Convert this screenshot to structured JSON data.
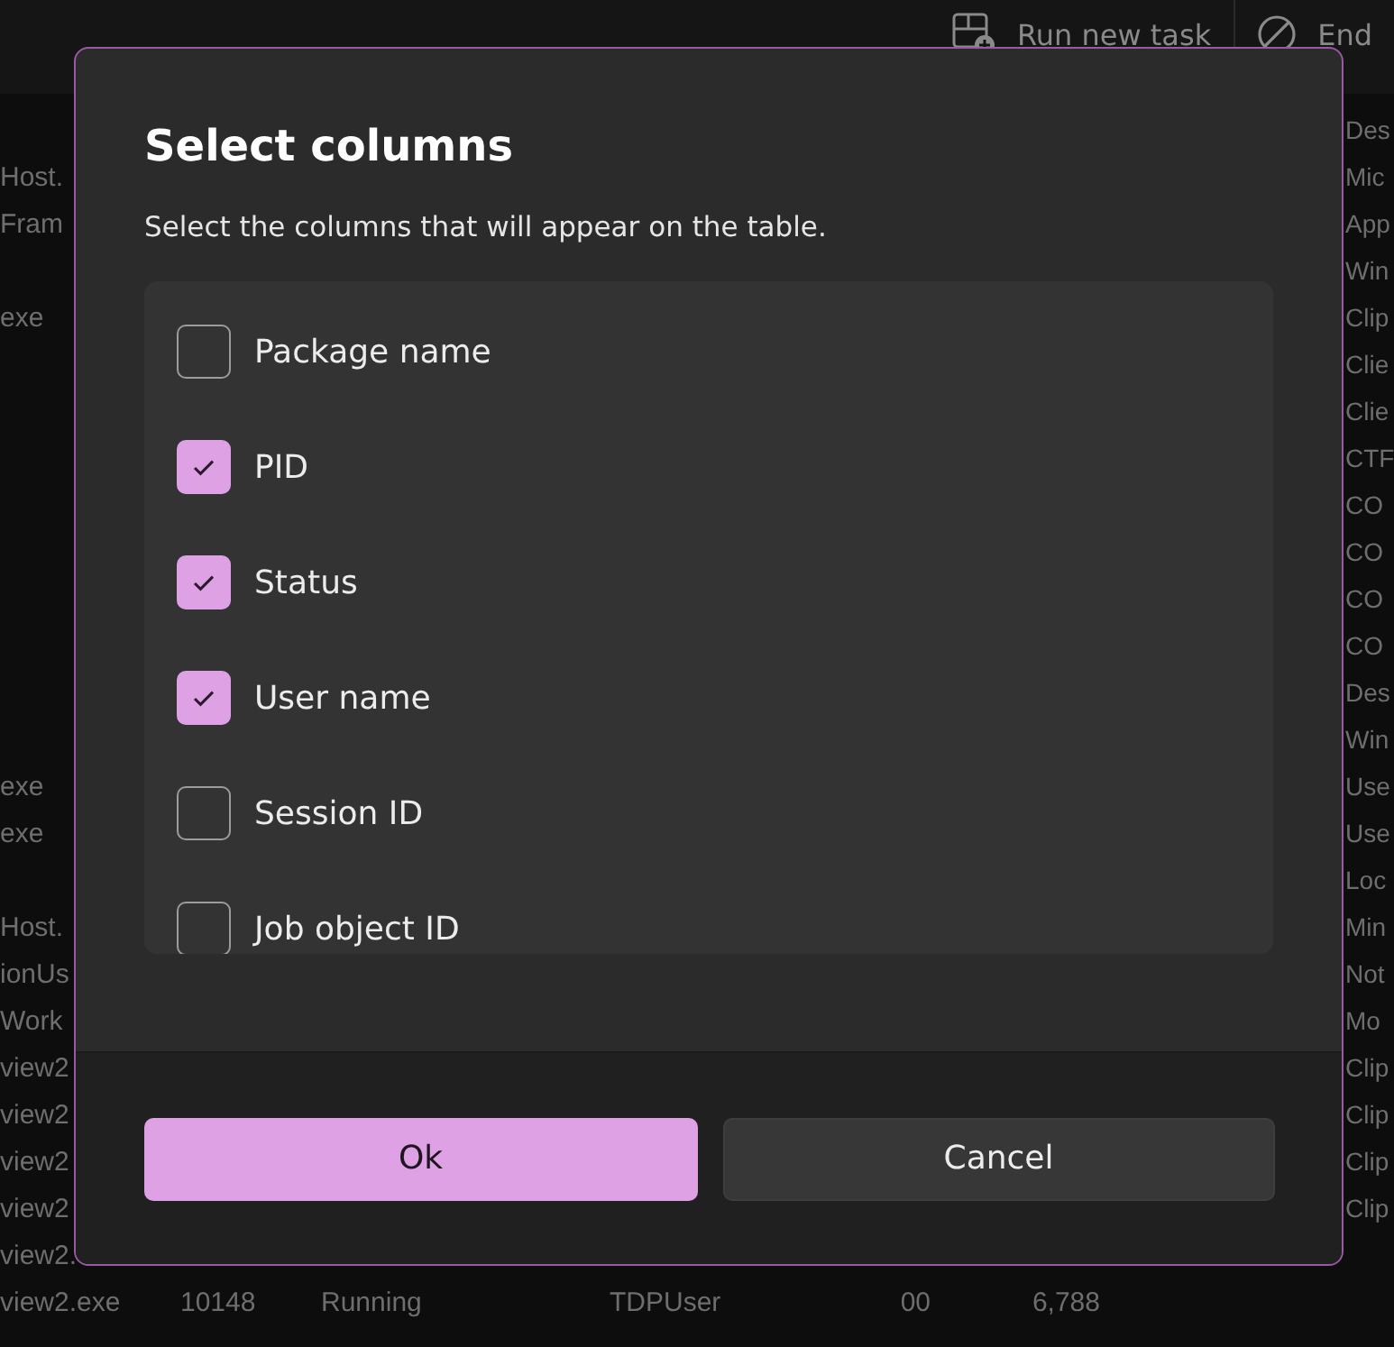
{
  "toolbar": [
    {
      "kind": "run",
      "label": "Run new task"
    },
    {
      "kind": "end",
      "label": "End"
    }
  ],
  "rows": [
    {
      "description": "Des"
    },
    {
      "name": "Host.",
      "description": "Mic"
    },
    {
      "name": "Fram",
      "description": "App"
    },
    {
      "description": "Win"
    },
    {
      "name": "exe",
      "description": "Clip"
    },
    {
      "description": "Clie"
    },
    {
      "description": "Clie"
    },
    {
      "description": "CTF"
    },
    {
      "description": "CO"
    },
    {
      "description": "CO"
    },
    {
      "description": "CO"
    },
    {
      "description": "CO"
    },
    {
      "description": "Des"
    },
    {
      "description": "Win"
    },
    {
      "name": "exe",
      "description": "Use"
    },
    {
      "name": "exe",
      "description": "Use"
    },
    {
      "description": "Loc"
    },
    {
      "name": "Host.",
      "description": "Min"
    },
    {
      "name": "ionUs",
      "description": "Not"
    },
    {
      "name": "Work",
      "description": "Mo"
    },
    {
      "name": "view2",
      "description": "Clip"
    },
    {
      "name": "view2",
      "description": "Clip"
    },
    {
      "name": "view2",
      "description": "Clip"
    },
    {
      "name": "view2",
      "description": "Clip"
    },
    {
      "name": "view2."
    },
    {
      "name": "view2.exe",
      "pid": "10148",
      "status": "Running",
      "user": "TDPUser",
      "session": "00",
      "memory": "6,788"
    }
  ],
  "dialog": {
    "title": "Select columns",
    "subtitle": "Select the columns that will appear on the table.",
    "options": [
      {
        "label": "Package name",
        "checked": false
      },
      {
        "label": "PID",
        "checked": true
      },
      {
        "label": "Status",
        "checked": true
      },
      {
        "label": "User name",
        "checked": true
      },
      {
        "label": "Session ID",
        "checked": false
      },
      {
        "label": "Job object ID",
        "checked": false
      }
    ],
    "buttons": [
      {
        "kind": "primary",
        "label": "Ok"
      },
      {
        "kind": "secondary",
        "label": "Cancel"
      }
    ]
  }
}
